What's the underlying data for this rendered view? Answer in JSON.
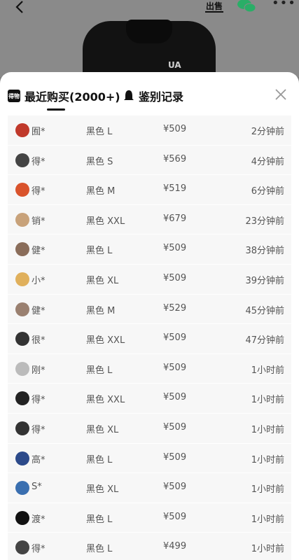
{
  "header": {
    "sell_label": "出售",
    "brand_logo_text": "UA"
  },
  "tabs": [
    {
      "label": "最近购买(2000+)",
      "icon": "dewu-logo-icon",
      "selected": true
    },
    {
      "label": "鉴别记录",
      "icon": "bell-icon",
      "selected": false
    }
  ],
  "records": [
    {
      "name": "囿*",
      "spec": "黑色 L",
      "price": "¥509",
      "time": "2分钟前",
      "avatar_color": "#c0392b"
    },
    {
      "name": "得*",
      "spec": "黑色 S",
      "price": "¥569",
      "time": "4分钟前",
      "avatar_color": "#444"
    },
    {
      "name": "得*",
      "spec": "黑色 M",
      "price": "¥519",
      "time": "6分钟前",
      "avatar_color": "#d9532c"
    },
    {
      "name": "销*",
      "spec": "黑色 XXL",
      "price": "¥679",
      "time": "23分钟前",
      "avatar_color": "#c8a27a"
    },
    {
      "name": "健*",
      "spec": "黑色 L",
      "price": "¥509",
      "time": "38分钟前",
      "avatar_color": "#8a6d5a"
    },
    {
      "name": "小*",
      "spec": "黑色 XL",
      "price": "¥509",
      "time": "39分钟前",
      "avatar_color": "#e0b05c"
    },
    {
      "name": "健*",
      "spec": "黑色 M",
      "price": "¥529",
      "time": "45分钟前",
      "avatar_color": "#9a8070"
    },
    {
      "name": "很*",
      "spec": "黑色 XXL",
      "price": "¥509",
      "time": "47分钟前",
      "avatar_color": "#333"
    },
    {
      "name": "刚*",
      "spec": "黑色 L",
      "price": "¥509",
      "time": "1小时前",
      "avatar_color": "#bbb"
    },
    {
      "name": "得*",
      "spec": "黑色 XXL",
      "price": "¥509",
      "time": "1小时前",
      "avatar_color": "#222"
    },
    {
      "name": "得*",
      "spec": "黑色 XL",
      "price": "¥509",
      "time": "1小时前",
      "avatar_color": "#333"
    },
    {
      "name": "高*",
      "spec": "黑色 L",
      "price": "¥509",
      "time": "1小时前",
      "avatar_color": "#2c4a8a"
    },
    {
      "name": "S*",
      "spec": "黑色 XL",
      "price": "¥509",
      "time": "1小时前",
      "avatar_color": "#3a6fb0"
    },
    {
      "name": "渡*",
      "spec": "黑色 L",
      "price": "¥509",
      "time": "1小时前",
      "avatar_color": "#111"
    },
    {
      "name": "得*",
      "spec": "黑色 L",
      "price": "¥499",
      "time": "1小时前",
      "avatar_color": "#444"
    }
  ]
}
